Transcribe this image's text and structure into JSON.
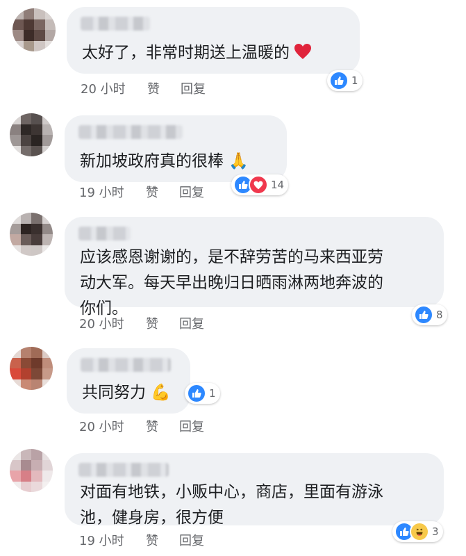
{
  "comments": [
    {
      "text": "太好了，非常时期送上温暖的",
      "emoji": "heart",
      "time": "20 小时",
      "like": "赞",
      "reply": "回复",
      "reactions": [
        "like"
      ],
      "count": "1"
    },
    {
      "text": "新加坡政府真的很棒",
      "emoji": "🙏",
      "time": "19 小时",
      "like": "赞",
      "reply": "回复",
      "reactions": [
        "like",
        "love"
      ],
      "count": "14"
    },
    {
      "text": "应该感恩谢谢的，是不辞劳苦的马来西亚劳\n动大军。每天早出晚归日晒雨淋两地奔波的\n你们。",
      "emoji": "",
      "time": "20 小时",
      "like": "赞",
      "reply": "回复",
      "reactions": [
        "like"
      ],
      "count": "8"
    },
    {
      "text": "共同努力",
      "emoji": "💪",
      "time": "20 小时",
      "like": "赞",
      "reply": "回复",
      "reactions": [
        "like"
      ],
      "count": "1"
    },
    {
      "text": "对面有地铁，小贩中心，商店，里面有游泳\n池，健身房，很方便",
      "emoji": "",
      "time": "19 小时",
      "like": "赞",
      "reply": "回复",
      "reactions": [
        "like",
        "haha"
      ],
      "count": "3"
    }
  ],
  "colors": {
    "like": "#2d88ff",
    "love": "#f0384d",
    "haha": "#f7c94a",
    "bubble": "#eff1f4"
  }
}
